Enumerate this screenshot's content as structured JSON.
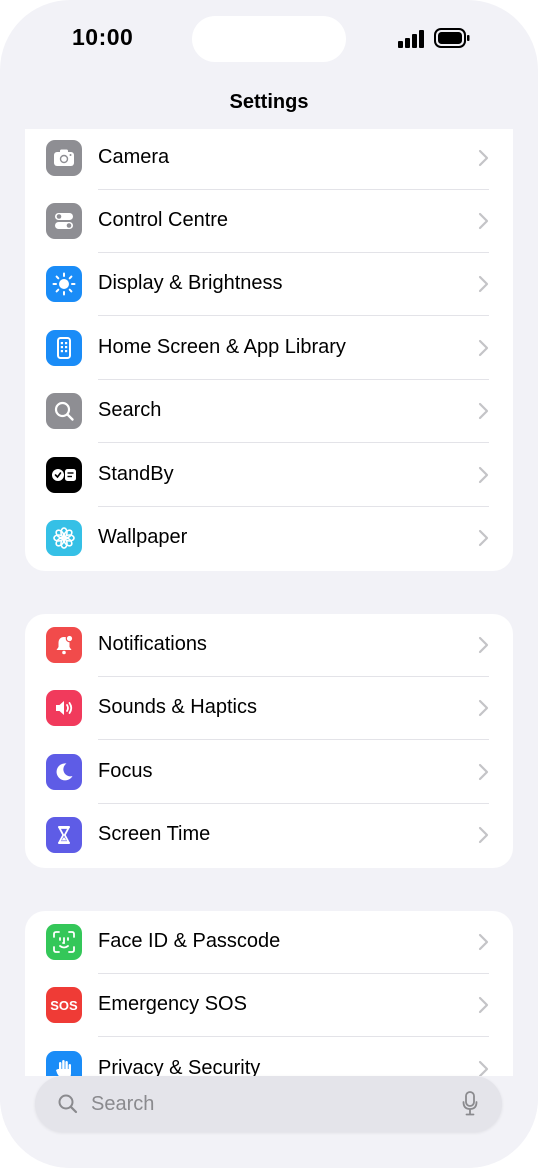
{
  "status_bar": {
    "time": "10:00"
  },
  "nav": {
    "title": "Settings"
  },
  "groups": [
    {
      "items": [
        {
          "label": "Camera",
          "icon": "camera-icon",
          "color": "#8e8e93"
        },
        {
          "label": "Control Centre",
          "icon": "toggles-icon",
          "color": "#8e8e93"
        },
        {
          "label": "Display & Brightness",
          "icon": "sun-icon",
          "color": "#1a8cf7"
        },
        {
          "label": "Home Screen & App Library",
          "icon": "phone-grid-icon",
          "color": "#1a8cf7"
        },
        {
          "label": "Search",
          "icon": "magnifier-icon",
          "color": "#8e8e93"
        },
        {
          "label": "StandBy",
          "icon": "standby-icon",
          "color": "#000000"
        },
        {
          "label": "Wallpaper",
          "icon": "flower-icon",
          "color": "#35c0e6"
        }
      ]
    },
    {
      "items": [
        {
          "label": "Notifications",
          "icon": "bell-icon",
          "color": "#f14b4b"
        },
        {
          "label": "Sounds & Haptics",
          "icon": "speaker-icon",
          "color": "#f13a5c"
        },
        {
          "label": "Focus",
          "icon": "moon-icon",
          "color": "#5e5ce6"
        },
        {
          "label": "Screen Time",
          "icon": "hourglass-icon",
          "color": "#5e5ce6"
        }
      ]
    },
    {
      "items": [
        {
          "label": "Face ID & Passcode",
          "icon": "faceid-icon",
          "color": "#34c759"
        },
        {
          "label": "Emergency SOS",
          "icon": "sos-icon",
          "color": "#ef3b36"
        },
        {
          "label": "Privacy & Security",
          "icon": "hand-icon",
          "color": "#1a8cf7"
        }
      ]
    }
  ],
  "search": {
    "placeholder": "Search"
  }
}
